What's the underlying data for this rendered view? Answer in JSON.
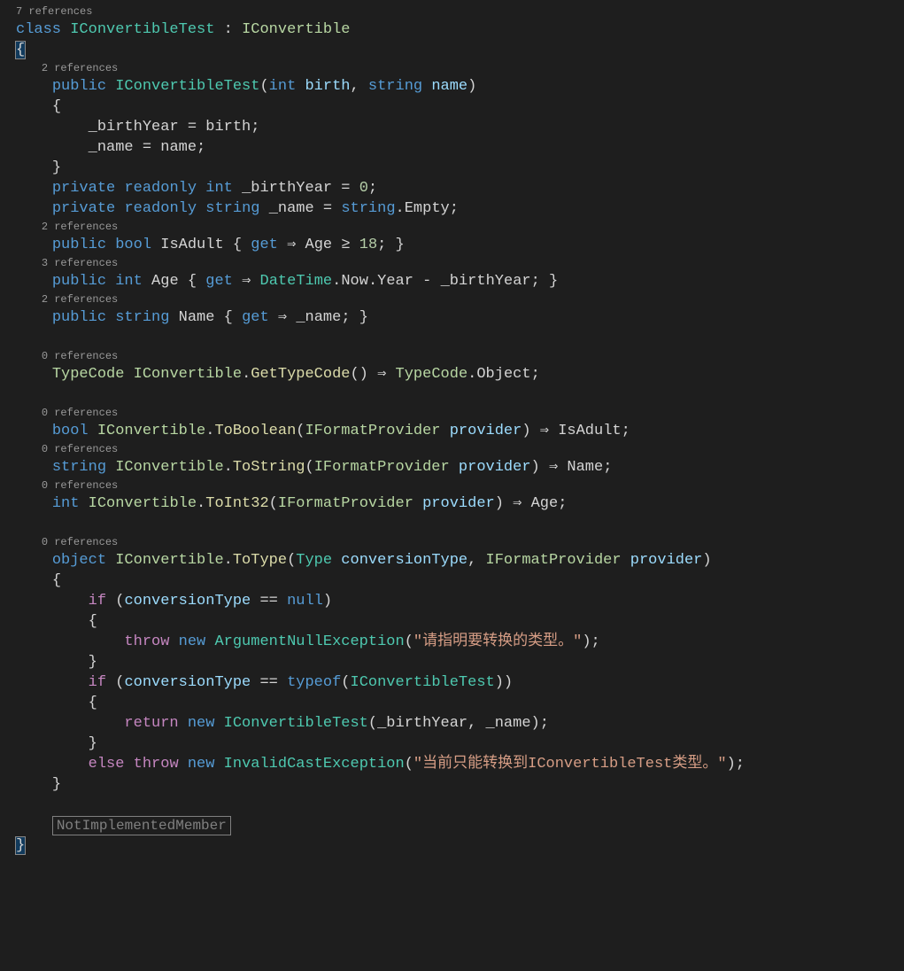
{
  "refs": {
    "class": "7 references",
    "ctor": "2 references",
    "isAdult": "2 references",
    "age": "3 references",
    "name": "2 references",
    "getTypeCode": "0 references",
    "toBoolean": "0 references",
    "toString": "0 references",
    "toInt32": "0 references",
    "toType": "0 references"
  },
  "code": {
    "className": "IConvertibleTest",
    "interfaceName": "IConvertible",
    "ctorParam1Type": "int",
    "ctorParam1Name": "birth",
    "ctorParam2Type": "string",
    "ctorParam2Name": "name",
    "field1": "_birthYear",
    "field2": "_name",
    "assign_birth": "_birthYear = birth;",
    "assign_name": "_name = name;",
    "fieldDecl1_pre": "private readonly int ",
    "fieldDecl1_default": "0",
    "fieldDecl2_pre": "private readonly string ",
    "fieldDecl2_default": "string.Empty",
    "isAdult_name": "IsAdult",
    "isAdult_body": "Age ≥ 18",
    "age_name": "Age",
    "age_body_prefix": "DateTime.Now.Year - ",
    "name_name": "Name",
    "typeCode": "TypeCode",
    "getTypeCode": "GetTypeCode",
    "typeCodeObject": "Object",
    "iFormatProvider": "IFormatProvider",
    "provider": "provider",
    "toBoolean": "ToBoolean",
    "toString": "ToString",
    "toInt32": "ToInt32",
    "toType": "ToType",
    "typeParam": "Type",
    "conversionType": "conversionType",
    "nullKw": "null",
    "argNullEx": "ArgumentNullException",
    "argNullMsg": "\"请指明要转换的类型。\"",
    "typeofKw": "typeof",
    "invalidCastEx": "InvalidCastException",
    "invalidCastMsg": "\"当前只能转换到IConvertibleTest类型。\"",
    "region": "NotImplementedMember"
  },
  "kw": {
    "class": "class",
    "public": "public",
    "private": "private",
    "readonly": "readonly",
    "int": "int",
    "string": "string",
    "bool": "bool",
    "object": "object",
    "get": "get",
    "if": "if",
    "else": "else",
    "return": "return",
    "throw": "throw",
    "new": "new"
  }
}
